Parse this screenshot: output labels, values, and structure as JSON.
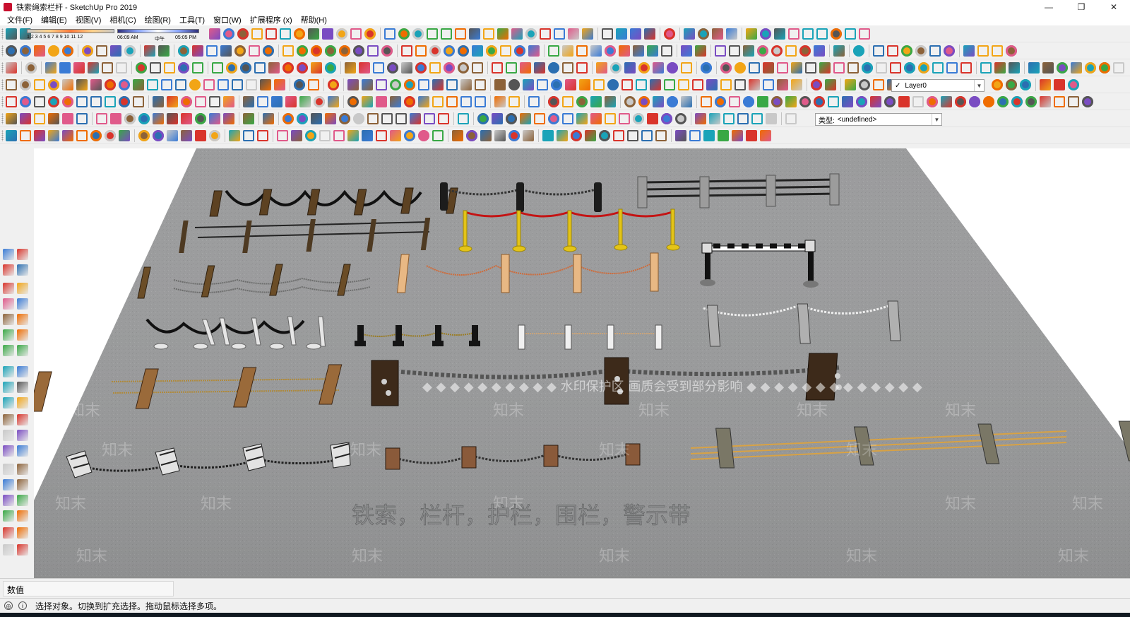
{
  "window": {
    "title": "铁索绳索栏杆 - SketchUp Pro 2019",
    "controls": [
      "—",
      "❐",
      "✕"
    ]
  },
  "menubar": [
    "文件(F)",
    "编辑(E)",
    "视图(V)",
    "相机(C)",
    "绘图(R)",
    "工具(T)",
    "窗口(W)",
    "扩展程序 (x)",
    "帮助(H)"
  ],
  "shadow": {
    "months": "1 2 3 4 5 6 7 8 9 10 11 12",
    "time_start": "06:09 AM",
    "time_mid": "中午",
    "time_end": "05:05 PM"
  },
  "layer_dropdown": {
    "check": "✓",
    "value": "Layer0"
  },
  "type_dropdown": {
    "label": "类型:",
    "value": "<undefined>"
  },
  "scene": {
    "caption": "铁索，栏杆，护栏，围栏，警示带",
    "watermark_banner": "◆ ◆ ◆ ◆ ◆ ◆ ◆ ◆ ◆ ◆ 水印保护区  画质会受到部分影响 ◆ ◆ ◆ ◆ ◆ ◆ ◆ ◆ ◆ ◆ ◆ ◆ ◆",
    "watermark_text": "知末",
    "ground_color": "#9a9b9c"
  },
  "status": {
    "value_label": "数值",
    "message": "选择对象。切换到扩充选择。拖动鼠标选择多项。"
  },
  "colors": {
    "toolbar_bg": "#f0f0f0",
    "viewport_bg": "#ffffff",
    "ground": "#9a9b9c"
  }
}
